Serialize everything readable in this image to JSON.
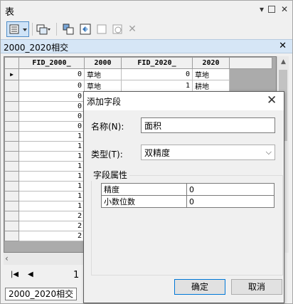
{
  "window": {
    "title": "表"
  },
  "tab_header": {
    "title": "2000_2020相交"
  },
  "grid": {
    "columns": [
      "FID_2000_",
      "2000",
      "FID_2020_",
      "2020"
    ],
    "rows": [
      [
        "0",
        "草地",
        "0",
        "草地"
      ],
      [
        "0",
        "草地",
        "1",
        "耕地"
      ],
      [
        "0",
        "",
        "",
        ""
      ],
      [
        "0",
        "",
        "",
        ""
      ],
      [
        "0",
        "",
        "",
        ""
      ],
      [
        "0",
        "",
        "",
        ""
      ],
      [
        "1",
        "",
        "",
        ""
      ],
      [
        "1",
        "",
        "",
        ""
      ],
      [
        "1",
        "",
        "",
        ""
      ],
      [
        "1",
        "",
        "",
        ""
      ],
      [
        "1",
        "",
        "",
        ""
      ],
      [
        "1",
        "",
        "",
        ""
      ],
      [
        "1",
        "",
        "",
        ""
      ],
      [
        "1",
        "",
        "",
        ""
      ],
      [
        "2",
        "",
        "",
        ""
      ],
      [
        "2",
        "",
        "",
        ""
      ],
      [
        "2",
        "",
        "",
        ""
      ]
    ]
  },
  "nav": {
    "page": "1"
  },
  "bottom_tab": {
    "label": "2000_2020相交"
  },
  "dialog": {
    "title": "添加字段",
    "name_label": "名称(N):",
    "name_value": "面积",
    "type_label": "类型(T):",
    "type_value": "双精度",
    "props_title": "字段属性",
    "props": [
      {
        "key": "精度",
        "value": "0"
      },
      {
        "key": "小数位数",
        "value": "0"
      }
    ],
    "ok_label": "确定",
    "cancel_label": "取消"
  }
}
